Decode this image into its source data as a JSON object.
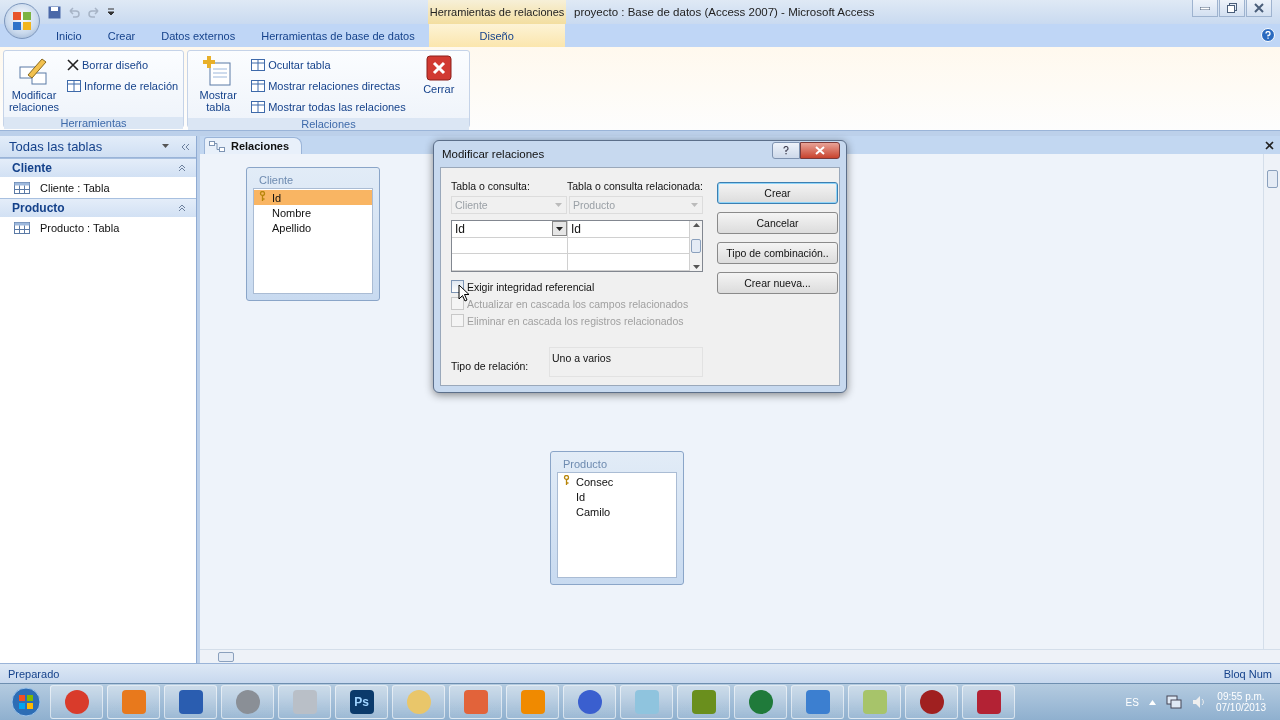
{
  "window": {
    "title": "proyecto : Base de datos (Access 2007)  -  Microsoft Access",
    "context_group": "Herramientas de relaciones"
  },
  "ribbon_tabs": [
    {
      "label": "Inicio",
      "selected": false
    },
    {
      "label": "Crear",
      "selected": false
    },
    {
      "label": "Datos externos",
      "selected": false
    },
    {
      "label": "Herramientas de base de datos",
      "selected": false
    },
    {
      "label": "Diseño",
      "selected": true
    }
  ],
  "ribbon_groups": [
    {
      "label": "Herramientas",
      "items": [
        {
          "kind": "large",
          "label": "Modificar relaciones"
        },
        {
          "kind": "stack",
          "labels": [
            "Borrar diseño",
            "Informe de relación"
          ]
        }
      ]
    },
    {
      "label": "Relaciones",
      "items": [
        {
          "kind": "large",
          "label": "Mostrar tabla"
        },
        {
          "kind": "stack",
          "labels": [
            "Ocultar tabla",
            "Mostrar relaciones directas",
            "Mostrar todas las relaciones"
          ]
        },
        {
          "kind": "large",
          "label": "Cerrar"
        }
      ]
    }
  ],
  "nav_pane": {
    "title": "Todas las tablas",
    "groups": [
      {
        "label": "Cliente",
        "expanded": true,
        "items": [
          "Cliente : Tabla"
        ]
      },
      {
        "label": "Producto",
        "expanded": true,
        "items": [
          "Producto : Tabla"
        ]
      }
    ]
  },
  "document_tab": "Relaciones",
  "tables": [
    {
      "title": "Cliente",
      "fields": [
        {
          "name": "Id",
          "key": true,
          "selected": true
        },
        {
          "name": "Nombre",
          "key": false,
          "selected": false
        },
        {
          "name": "Apellido",
          "key": false,
          "selected": false
        }
      ]
    },
    {
      "title": "Producto",
      "fields": [
        {
          "name": "Consec",
          "key": true,
          "selected": false
        },
        {
          "name": "Id",
          "key": false,
          "selected": false
        },
        {
          "name": "Camilo",
          "key": false,
          "selected": false
        }
      ]
    }
  ],
  "dialog": {
    "title": "Modificar relaciones",
    "table_label": "Tabla o consulta:",
    "related_label": "Tabla o consulta relacionada:",
    "table": "Cliente",
    "related_table": "Producto",
    "field_pairs": [
      {
        "left": "Id",
        "right": "Id"
      }
    ],
    "checkboxes": [
      {
        "label": "Exigir integridad referencial",
        "checked": false,
        "disabled": false
      },
      {
        "label": "Actualizar en cascada los campos relacionados",
        "checked": false,
        "disabled": true
      },
      {
        "label": "Eliminar en cascada los registros relacionados",
        "checked": false,
        "disabled": true
      }
    ],
    "relation_type_label": "Tipo de relación:",
    "relation_type": "Uno a varios",
    "buttons": [
      {
        "label": "Crear",
        "default": true
      },
      {
        "label": "Cancelar",
        "default": false
      },
      {
        "label": "Tipo de combinación..",
        "default": false
      },
      {
        "label": "Crear nueva...",
        "default": false
      }
    ]
  },
  "status_bar": {
    "left": "Preparado",
    "right": "Bloq Num"
  },
  "taskbar": {
    "apps": [
      {
        "color": "#d93b2b"
      },
      {
        "color": "#e8791c"
      },
      {
        "color": "#2a5db0"
      },
      {
        "color": "#8a8f96"
      },
      {
        "color": "#b9bfc7"
      },
      {
        "color": "#0b3a6b",
        "label": "Ps"
      },
      {
        "color": "#e9c66a"
      },
      {
        "color": "#e2633a"
      },
      {
        "color": "#f08a00"
      },
      {
        "color": "#3a5fcf"
      },
      {
        "color": "#8fc4de"
      },
      {
        "color": "#6a8f1d"
      },
      {
        "color": "#1f7a3a"
      },
      {
        "color": "#3c7fd0"
      },
      {
        "color": "#a7c46a"
      },
      {
        "color": "#a02020"
      },
      {
        "color": "#b32234"
      }
    ],
    "language": "ES",
    "time": "09:55 p.m.",
    "date": "07/10/2013"
  }
}
